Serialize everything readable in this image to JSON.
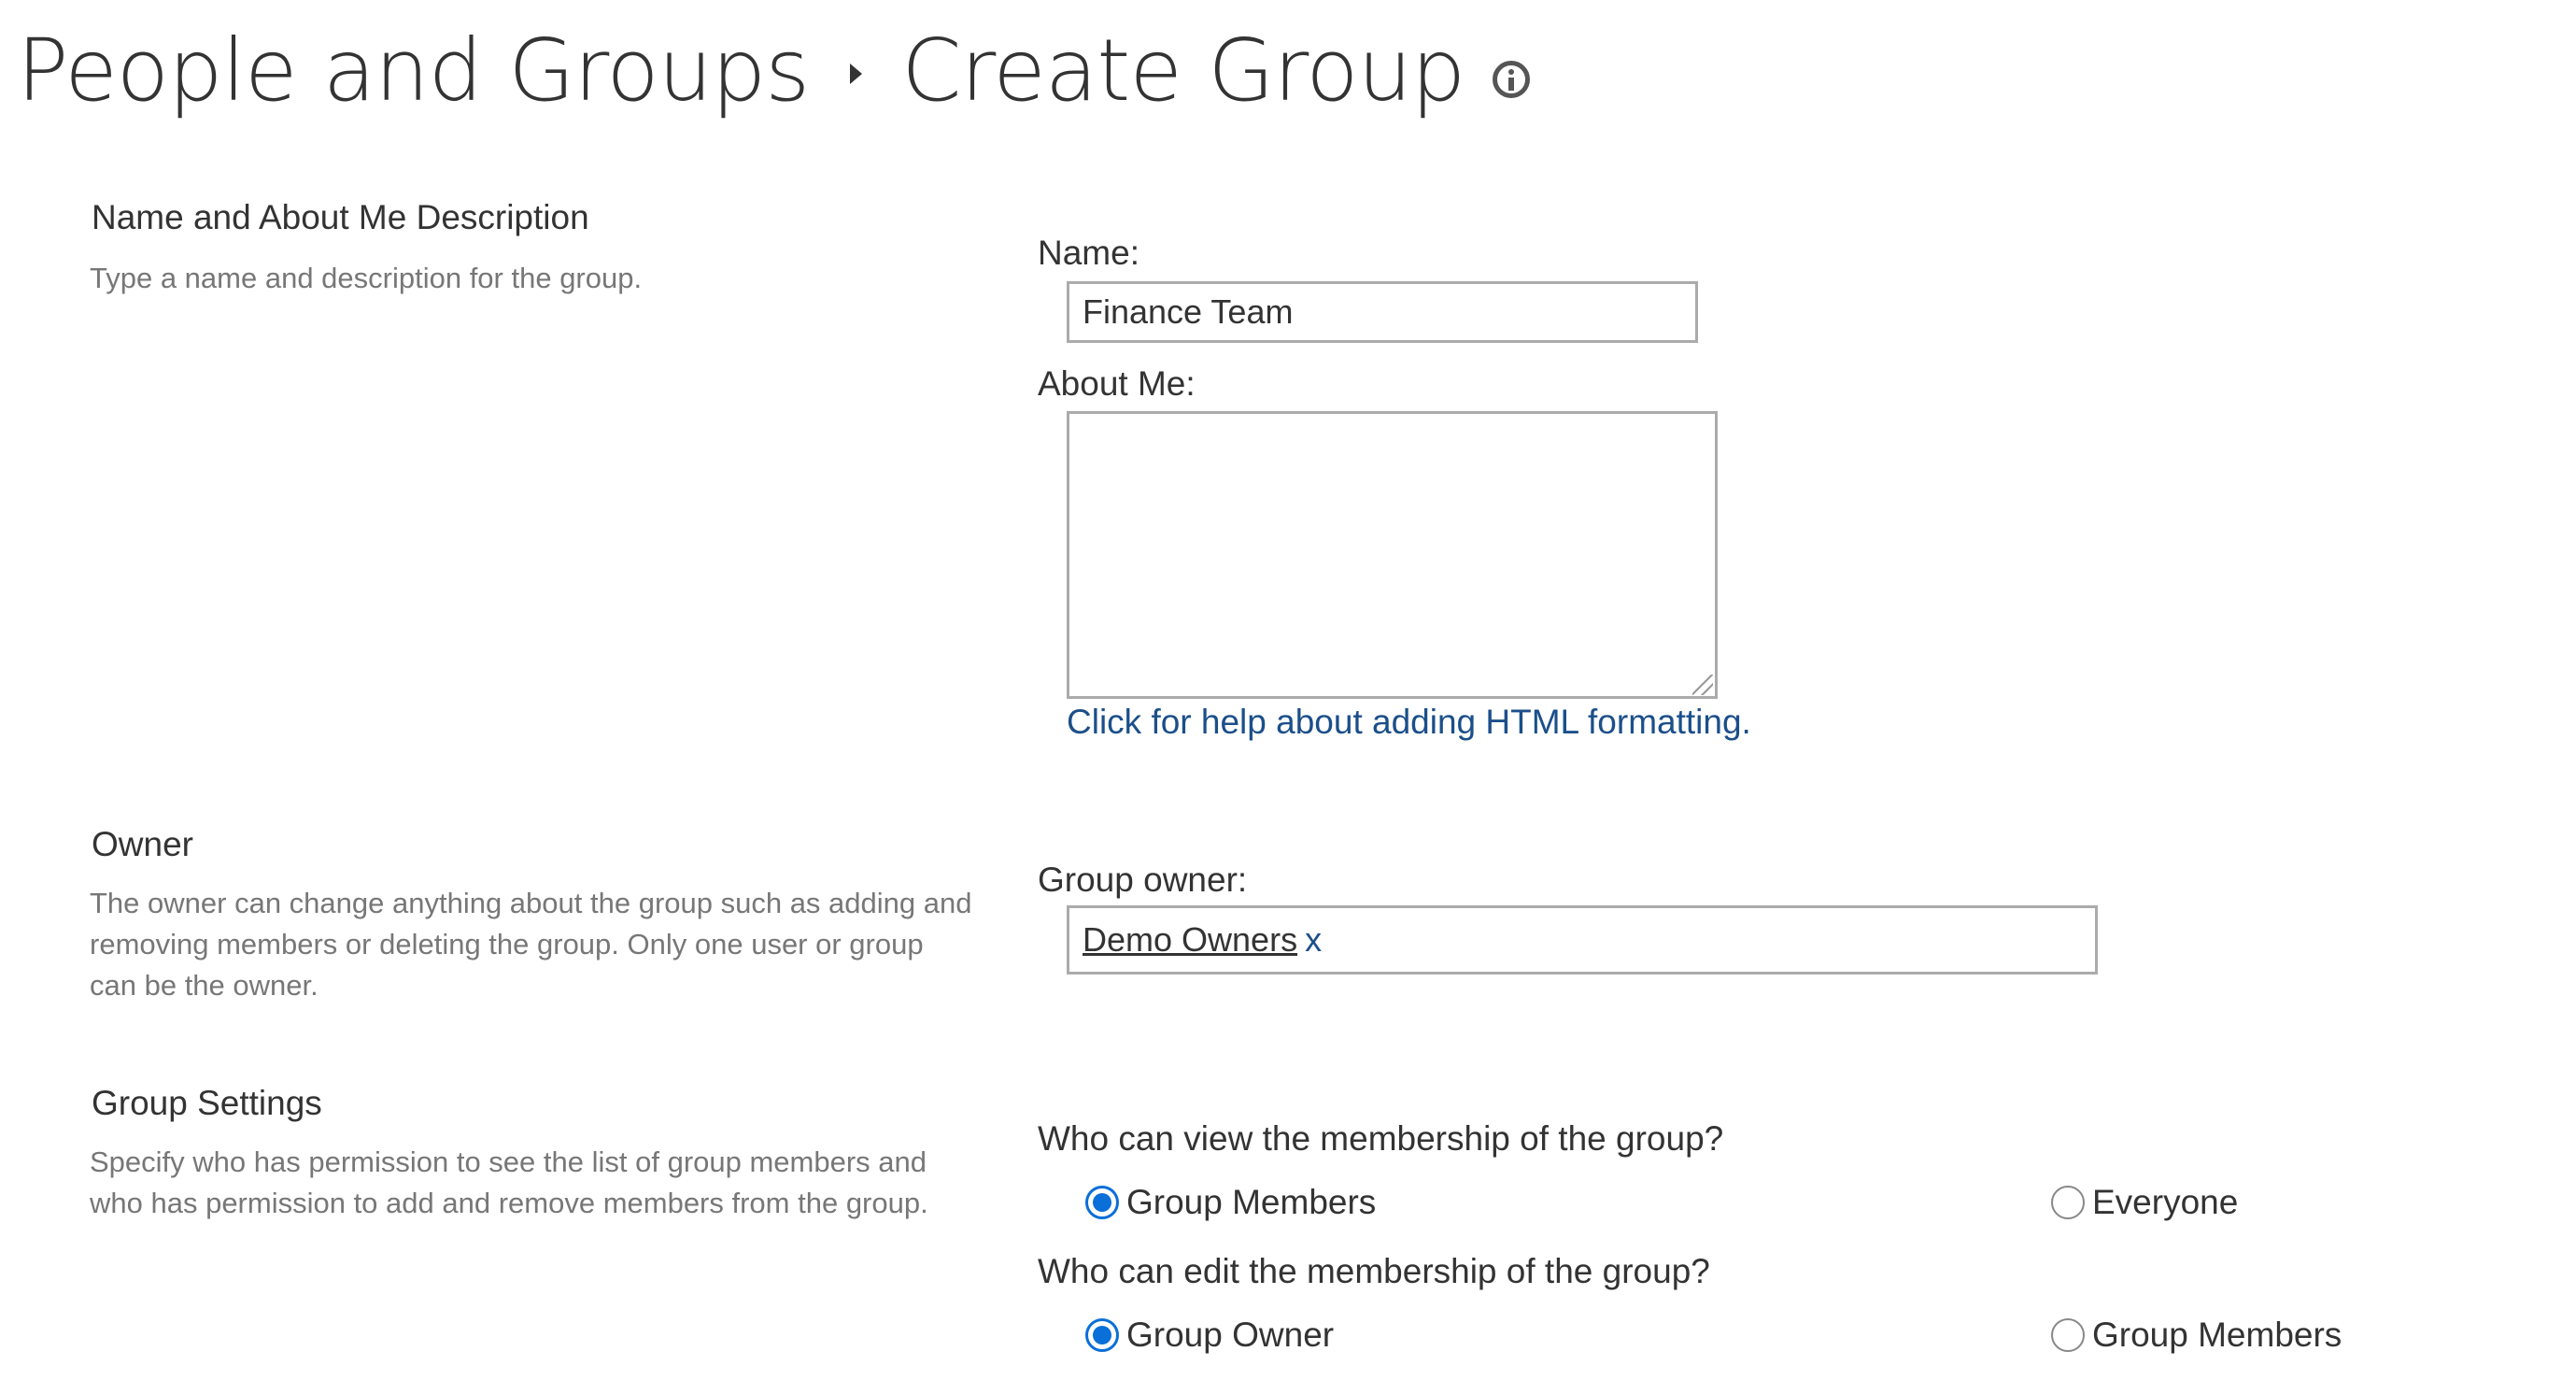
{
  "header": {
    "breadcrumb_parent": "People and Groups",
    "breadcrumb_current": "Create Group",
    "info_icon": "info-icon"
  },
  "sections": {
    "name": {
      "title": "Name and About Me Description",
      "description": "Type a name and description for the group.",
      "name_label": "Name:",
      "name_value": "Finance Team",
      "about_label": "About Me:",
      "about_value": "",
      "help_link": "Click for help about adding HTML formatting."
    },
    "owner": {
      "title": "Owner",
      "description": "The owner can change anything about the group such as adding and removing members or deleting the group. Only one user or group can be the owner.",
      "owner_label": "Group owner:",
      "owner_value": "Demo Owners",
      "remove_label": "x"
    },
    "settings": {
      "title": "Group Settings",
      "description": "Specify who has permission to see the list of group members and who has permission to add and remove members from the group.",
      "view_question": "Who can view the membership of the group?",
      "view_options": [
        "Group Members",
        "Everyone"
      ],
      "view_selected": "Group Members",
      "edit_question": "Who can edit the membership of the group?",
      "edit_options": [
        "Group Owner",
        "Group Members"
      ],
      "edit_selected": "Group Owner"
    }
  },
  "colors": {
    "link": "#1b4f8a",
    "radio_selected": "#0a6fd8",
    "description_text": "#777777",
    "input_border": "#ababab"
  }
}
